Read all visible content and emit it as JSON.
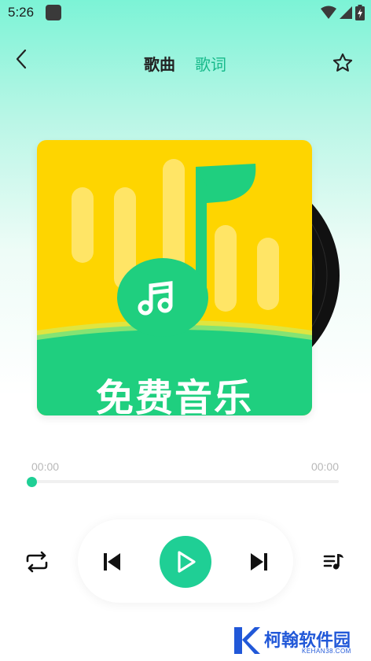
{
  "status_bar": {
    "time": "5:26",
    "icons": [
      "app-notification-icon",
      "wifi-icon",
      "cell-signal-icon",
      "battery-icon"
    ]
  },
  "header": {
    "back_icon": "chevron-left-icon",
    "tabs": [
      {
        "label": "歌曲",
        "active": true
      },
      {
        "label": "歌词",
        "active": false
      }
    ],
    "favorite_icon": "star-outline-icon"
  },
  "album": {
    "cover_text": "免费音乐",
    "cover_icon": "music-note-icon",
    "colors": {
      "yellow": "#fed500",
      "green": "#1fcf7f"
    }
  },
  "player": {
    "elapsed": "00:00",
    "duration": "00:00",
    "progress": 0,
    "accent_color": "#1fcf95"
  },
  "controls": {
    "repeat_icon": "repeat-icon",
    "previous_icon": "skip-previous-icon",
    "play_icon": "play-icon",
    "next_icon": "skip-next-icon",
    "playlist_icon": "playlist-icon"
  },
  "watermark": {
    "name": "柯翰软件园",
    "url": "KEHAN38.COM"
  }
}
